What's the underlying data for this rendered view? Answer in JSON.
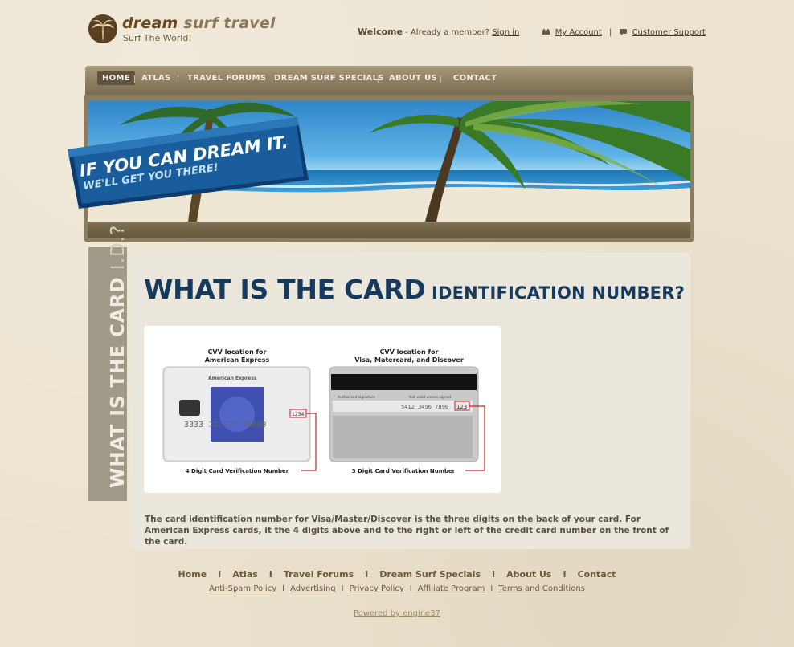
{
  "brand": {
    "name_bold": "dream",
    "name_rest": "surf travel",
    "tagline": "Surf The World!"
  },
  "toplinks": {
    "welcome": "Welcome",
    "member_prompt": " - Already a member? ",
    "sign_in": "Sign in",
    "my_account": "My Account",
    "support": "Customer Support",
    "separator": "|"
  },
  "nav": {
    "items": [
      "HOME",
      "ATLAS",
      "TRAVEL FORUMS",
      "DREAM SURF SPECIALS",
      "ABOUT US",
      "CONTACT"
    ],
    "active": "HOME"
  },
  "banner": {
    "slogan_line1": "IF YOU CAN DREAM IT.",
    "slogan_line2": "WE'LL GET YOU THERE!"
  },
  "sidebar": {
    "title_bold": "WHAT IS THE CARD",
    "title_thin": " I.D.?"
  },
  "content": {
    "heading_big": "WHAT IS THE CARD",
    "heading_small": " IDENTIFICATION NUMBER?",
    "card_left_title_1": "CVV location for",
    "card_left_title_2": "American Express",
    "card_left_brand": "American Express",
    "card_left_number": "3333  122222  20000",
    "card_left_code": "1234",
    "card_left_caption": "4 Digit Card Verification Number",
    "card_right_title_1": "CVV location for",
    "card_right_title_2": "Visa, Matercard, and Discover",
    "card_right_sig_label": "Authorized signature",
    "card_right_sig_note": "Not valid unless signed",
    "card_right_numbers": "5412 3456 7890",
    "card_right_code": "123",
    "card_right_caption": "3 Digit Card Verification Number",
    "body": "The card identification number for Visa/Master/Discover is the three digits on the back of your card. For American Express cards, it the 4 digits above and to the right or left of the credit card number on the front of the card."
  },
  "footer": {
    "nav": [
      "Home",
      "Atlas",
      "Travel Forums",
      "Dream Surf Specials",
      "About Us",
      "Contact"
    ],
    "nav_separator": "I",
    "links": [
      "Anti-Spam Policy",
      "Advertising",
      "Privacy Policy",
      "Affiliate Program",
      "Terms and Conditions"
    ],
    "links_separator": "I",
    "powered": "Powered by engine37"
  },
  "colors": {
    "background": "#ece3cf",
    "heading": "#16395e",
    "nav_bar": "#8d7f62",
    "content_bg": "#ebe7dc",
    "cvv_highlight": "#c8202a"
  }
}
